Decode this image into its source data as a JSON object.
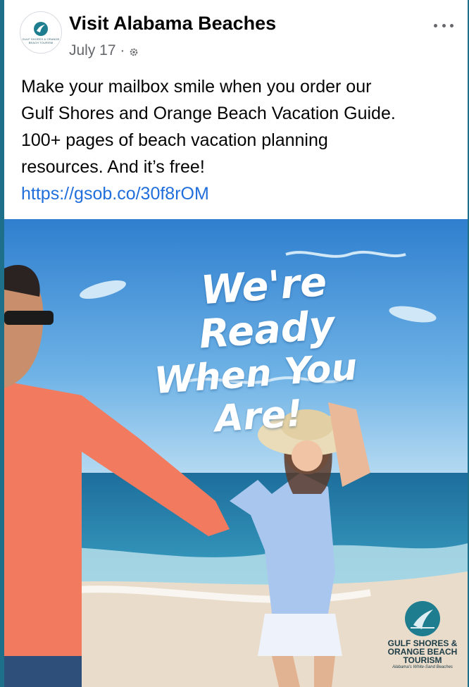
{
  "post": {
    "page_name": "Visit Alabama Beaches",
    "date": "July 17 ·",
    "privacy_icon": "gear-icon",
    "more_icon": "more-options-icon",
    "avatar_text": "GULF SHORES & ORANGE BEACH TOURISM",
    "text_lines": [
      "Make your mailbox smile when you order our",
      "Gulf Shores and Orange Beach Vacation Guide.",
      "100+ pages of beach vacation planning",
      "resources. And it’s free!"
    ],
    "link": "https://gsob.co/30f8rOM"
  },
  "image": {
    "headline_line1": "We're Ready",
    "headline_line2": "When You Are!",
    "brand_line1": "GULF SHORES &",
    "brand_line2": "ORANGE BEACH",
    "brand_line3": "TOURISM",
    "brand_tagline": "Alabama's White-Sand Beaches"
  },
  "colors": {
    "link": "#216fdb",
    "page_border": "#1d6f8a",
    "sky": "#3d90d8",
    "sea": "#2d7fa8",
    "sand": "#e8d9c4"
  }
}
